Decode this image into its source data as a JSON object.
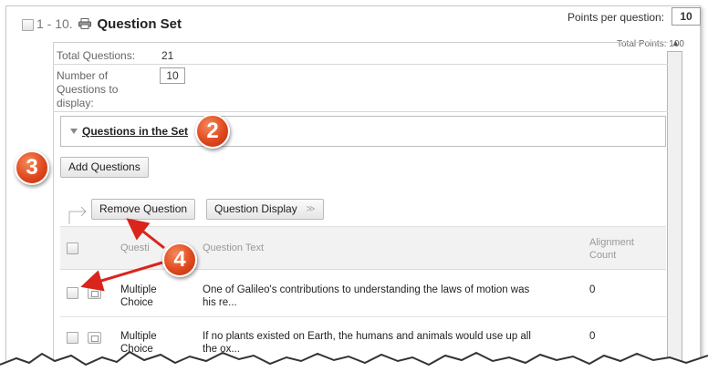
{
  "header": {
    "number_range": "1 - 10.",
    "title": "Question Set",
    "points_label": "Points per question:",
    "points_value": "10",
    "total_points": "Total Points: 100"
  },
  "summary": {
    "total_questions_label": "Total Questions:",
    "total_questions_value": "21",
    "display_label_1": "Number of",
    "display_label_2": "Questions to",
    "display_label_3": "display:",
    "display_value": "10"
  },
  "section": {
    "questions_in_set": "Questions in the Set"
  },
  "actions": {
    "add_questions": "Add Questions",
    "remove_question": "Remove Question",
    "question_display": "Question Display"
  },
  "table": {
    "headers": {
      "type": "Questi",
      "text": "Question Text",
      "alignment_1": "Alignment",
      "alignment_2": "Count"
    },
    "rows": [
      {
        "type_1": "Multiple",
        "type_2": "Choice",
        "text_1": "One of Galileo's contributions to understanding the laws of motion was",
        "text_2": "his re...",
        "alignment": "0"
      },
      {
        "type_1": "Multiple",
        "type_2": "Choice",
        "text_1": "If no plants existed on Earth, the humans and animals would use up all",
        "text_2": "the ox...",
        "alignment": "0"
      }
    ]
  },
  "callouts": {
    "two": "2",
    "three": "3",
    "four": "4"
  },
  "colors": {
    "callout": "#e0491f",
    "arrow": "#d9251c"
  }
}
